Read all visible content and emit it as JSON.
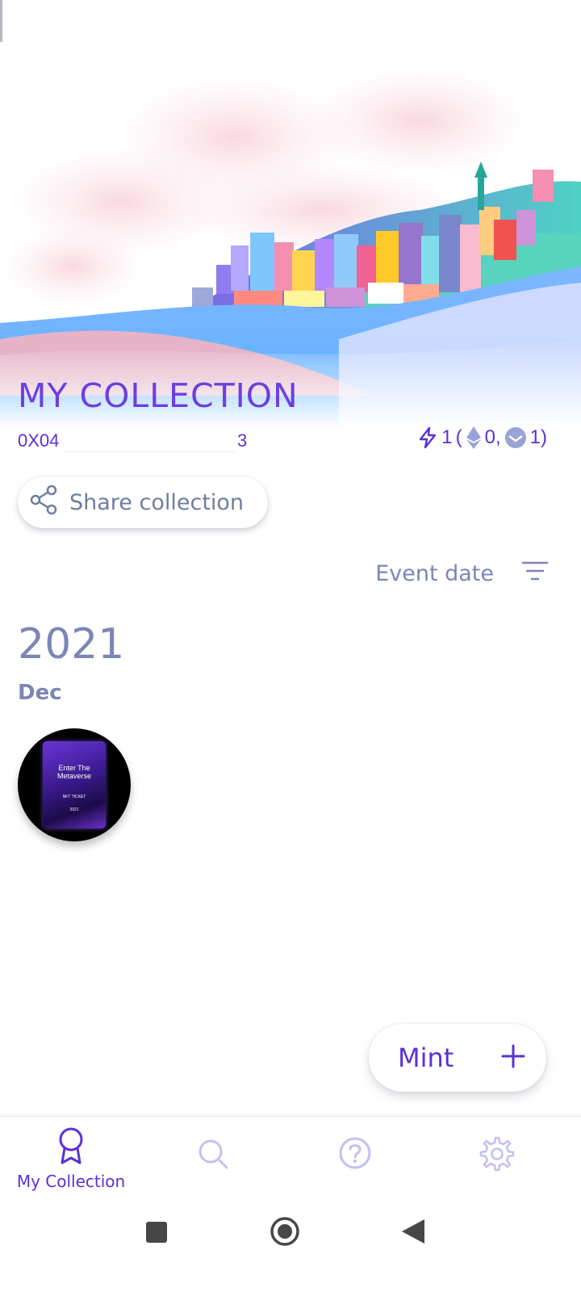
{
  "header": {
    "title": "MY COLLECTION",
    "address_prefix": "0X04",
    "address_suffix": "3"
  },
  "stats": {
    "total": "1",
    "open_paren": "(",
    "eth_count": "0,",
    "gnosis_count": "1)"
  },
  "share_button": {
    "label": "Share collection"
  },
  "sort": {
    "label": "Event date"
  },
  "timeline": {
    "year": "2021",
    "month": "Dec",
    "token": {
      "line1": "Enter The",
      "line2": "Metaverse",
      "subtitle": "NFT TICKET",
      "year": "2021"
    }
  },
  "mint_button": {
    "label": "Mint",
    "icon": "plus-icon"
  },
  "bottom_nav": {
    "items": [
      {
        "label": "My Collection",
        "icon": "award-icon",
        "active": true
      },
      {
        "label": "",
        "icon": "search-icon",
        "active": false
      },
      {
        "label": "",
        "icon": "help-icon",
        "active": false
      },
      {
        "label": "",
        "icon": "settings-icon",
        "active": false
      }
    ]
  },
  "colors": {
    "accent": "#5b31d6",
    "muted": "#7b86b6",
    "inactive_icon": "#c3c0f2"
  }
}
